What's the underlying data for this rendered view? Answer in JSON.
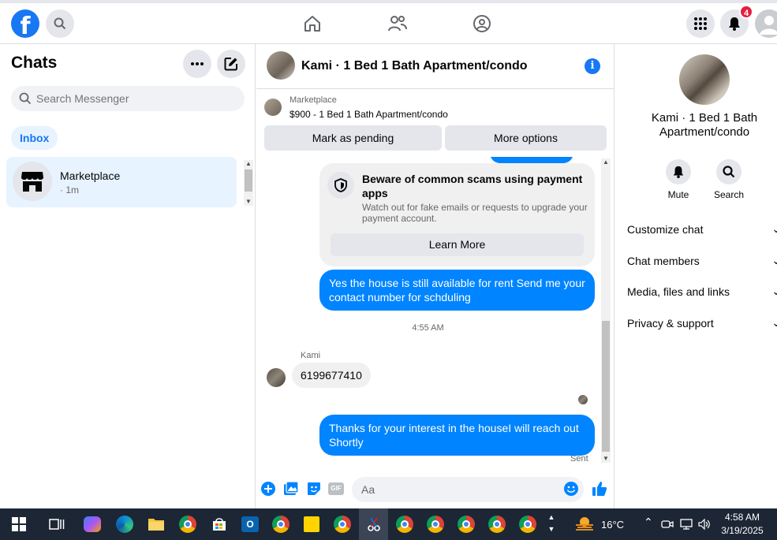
{
  "topbar": {
    "logo": "f",
    "notification_count": "4"
  },
  "left": {
    "title": "Chats",
    "search_placeholder": "Search Messenger",
    "inbox_label": "Inbox",
    "conversations": [
      {
        "name": "Marketplace",
        "time": "· 1m"
      }
    ]
  },
  "center": {
    "header_title": "Kami · 1 Bed 1 Bath Apartment/condo",
    "marketplace_label": "Marketplace",
    "listing": "$900 - 1 Bed 1 Bath Apartment/condo",
    "mark_pending": "Mark as pending",
    "more_options": "More options",
    "scam_title": "Beware of common scams using payment apps",
    "scam_body": "Watch out for fake emails or requests to upgrade your payment account.",
    "learn_more": "Learn More",
    "msg1": "Yes the house is still available for rent Send me your contact number for schduling",
    "timestamp": "4:55 AM",
    "sender": "Kami",
    "msg2": "6199677410",
    "msg3": "Thanks for your interest in the houseI will reach out Shortly",
    "sent": "Sent",
    "composer_placeholder": "Aa",
    "gif": "GIF"
  },
  "right": {
    "name": "Kami · 1 Bed 1 Bath Apartment/condo",
    "mute": "Mute",
    "search": "Search",
    "menu": [
      "Customize chat",
      "Chat members",
      "Media, files and links",
      "Privacy & support"
    ]
  },
  "taskbar": {
    "temp": "16°C",
    "time": "4:58 AM",
    "date": "3/19/2025"
  },
  "colors": {
    "brand": "#1877f2",
    "bubble": "#0084ff",
    "taskbar": "#1c2635"
  }
}
